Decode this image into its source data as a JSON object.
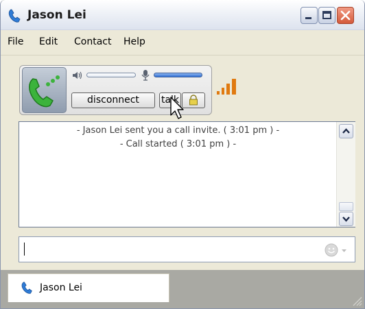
{
  "window": {
    "title": "Jason Lei",
    "controls": [
      "minimize-icon",
      "maximize-icon",
      "close-icon"
    ]
  },
  "menu": {
    "items": [
      "File",
      "Edit",
      "Contact",
      "Help"
    ]
  },
  "call": {
    "icon": "phone-call-icon",
    "speaker_icon": "speaker-icon",
    "mic_icon": "microphone-icon",
    "disconnect_label": "disconnect",
    "talk_label": "talk",
    "lock_icon": "lock-icon",
    "signal_icon": "signal-strength-icon",
    "speaker_level": 0.0,
    "mic_level": 1.0
  },
  "log": {
    "lines": [
      "- Jason Lei sent you a call invite. ( 3:01 pm ) -",
      "- Call started ( 3:01 pm ) -"
    ]
  },
  "message": {
    "value": "",
    "emoticon_icon": "smiley-icon"
  },
  "tabs": [
    {
      "label": "Jason Lei",
      "icon": "phone-icon"
    }
  ],
  "colors": {
    "accent": "#2f6fd6",
    "signal": "#e07a10",
    "call_green": "#3cb33c"
  }
}
